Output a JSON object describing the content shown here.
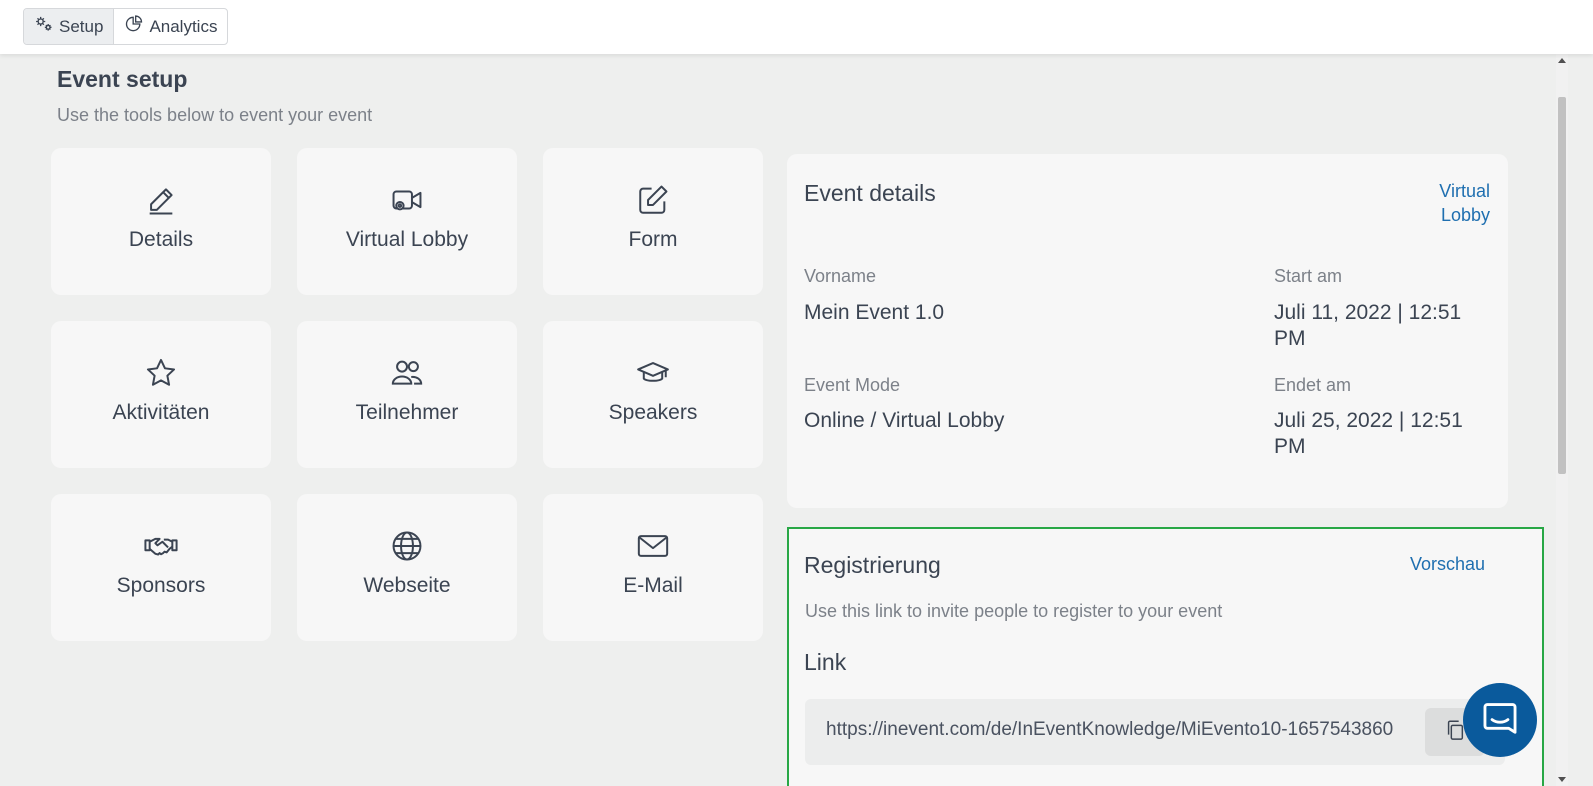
{
  "tabs": [
    {
      "label": "Setup",
      "icon": "gears-icon",
      "active": true
    },
    {
      "label": "Analytics",
      "icon": "pie-chart-icon",
      "active": false
    }
  ],
  "page": {
    "title": "Event setup",
    "subtitle": "Use the tools below to event your event"
  },
  "tiles": [
    {
      "label": "Details",
      "icon": "pencil-icon"
    },
    {
      "label": "Virtual Lobby",
      "icon": "video-camera-gear-icon"
    },
    {
      "label": "Form",
      "icon": "edit-square-icon"
    },
    {
      "label": "Aktivitäten",
      "icon": "star-icon"
    },
    {
      "label": "Teilnehmer",
      "icon": "people-icon"
    },
    {
      "label": "Speakers",
      "icon": "graduation-cap-icon"
    },
    {
      "label": "Sponsors",
      "icon": "handshake-icon"
    },
    {
      "label": "Webseite",
      "icon": "globe-icon"
    },
    {
      "label": "E-Mail",
      "icon": "envelope-icon"
    }
  ],
  "event_details": {
    "title": "Event details",
    "link": "Virtual Lobby",
    "name_label": "Vorname",
    "name_value": "Mein Event 1.0",
    "start_label": "Start am",
    "start_value": "Juli 11, 2022 | 12:51 PM",
    "mode_label": "Event Mode",
    "mode_value": "Online / Virtual Lobby",
    "end_label": "Endet am",
    "end_value": "Juli 25, 2022 | 12:51 PM"
  },
  "registration": {
    "title": "Registrierung",
    "preview": "Vorschau",
    "subtitle": "Use this link to invite people to register to your event",
    "link_heading": "Link",
    "url": "https://inevent.com/de/InEventKnowledge/MiEvento10-1657543860"
  },
  "colors": {
    "accent_link": "#1f6fb0",
    "highlight_border": "#28a745",
    "chat_bubble": "#0a5a9c"
  }
}
